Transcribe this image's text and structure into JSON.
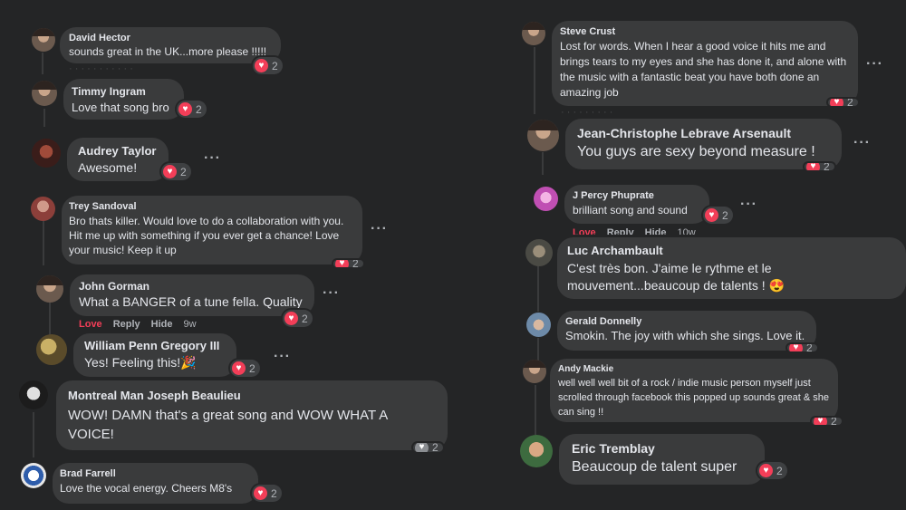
{
  "comments": [
    {
      "author": "David Hector",
      "text": "sounds great in the UK...more please !!!!!",
      "reactions": "2"
    },
    {
      "author": "Timmy Ingram",
      "text": "Love that song bro",
      "reactions": "2"
    },
    {
      "author": "Audrey Taylor",
      "text": "Awesome!",
      "reactions": "2"
    },
    {
      "author": "Trey Sandoval",
      "text": "Bro thats killer. Would love to do a collaboration with you. Hit me up with something if you ever get a chance! Love your music! Keep it up",
      "reactions": "2"
    },
    {
      "author": "John Gorman",
      "text": "What a BANGER of a tune fella. Quality",
      "reactions": "2",
      "actions": {
        "love": "Love",
        "reply": "Reply",
        "hide": "Hide",
        "time": "9w"
      }
    },
    {
      "author": "William Penn Gregory III",
      "text": "Yes! Feeling this!🎉",
      "reactions": "2"
    },
    {
      "author": "Montreal Man Joseph Beaulieu",
      "text": "WOW! DAMN that's a great song and WOW WHAT A VOICE!",
      "reactions": "2"
    },
    {
      "author": "Brad Farrell",
      "text": "Love the vocal energy. Cheers M8's",
      "reactions": "2"
    },
    {
      "author": "Steve Crust",
      "text": "Lost for words. When I hear a good voice it hits me and brings tears to my eyes and she has done it, and alone with the music with a fantastic beat you have both done an amazing job",
      "reactions": "2"
    },
    {
      "author": "Jean-Christophe Lebrave Arsenault",
      "text": "You guys are sexy beyond measure !",
      "reactions": "2"
    },
    {
      "author": "J Percy Phuprate",
      "text": "brilliant song and sound",
      "reactions": "2",
      "actions": {
        "love": "Love",
        "reply": "Reply",
        "hide": "Hide",
        "time": "10w"
      }
    },
    {
      "author": "Luc Archambault",
      "text": "C'est très bon. J'aime le rythme et le mouvement...beaucoup de talents ! 😍"
    },
    {
      "author": "Gerald Donnelly",
      "text": "Smokin. The joy with which she sings. Love it.",
      "reactions": "2"
    },
    {
      "author": "Andy Mackie",
      "text": "well well well bit of a rock / indie music person myself just scrolled through facebook this popped up sounds great & she can sing !!",
      "reactions": "2"
    },
    {
      "author": "Eric Tremblay",
      "text": "Beaucoup de talent super",
      "reactions": "2"
    }
  ],
  "icons": {
    "heart": "heart-icon",
    "more": "more-icon"
  },
  "colors": {
    "background": "#242526",
    "bubble": "#3a3b3c",
    "love": "#f33e58",
    "muted": "#b0b3b8"
  }
}
